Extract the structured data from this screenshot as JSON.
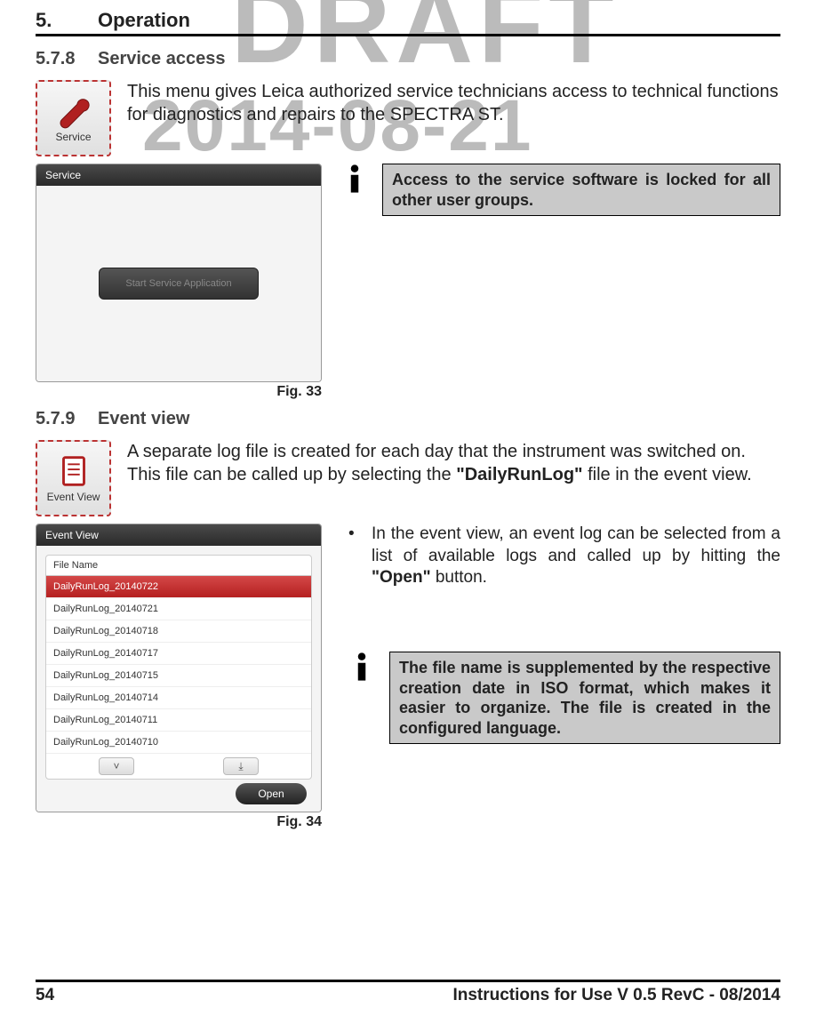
{
  "watermark": {
    "draft": "DRAFT",
    "date": "2014-08-21"
  },
  "chapter": {
    "num": "5.",
    "title": "Operation"
  },
  "sec578": {
    "num": "5.7.8",
    "title": "Service access",
    "icon_label": "Service",
    "intro": "This menu gives Leica authorized service technicians access to technical functions for diagnostics and repairs to the SPECTRA ST.",
    "screenshot_title": "Service",
    "service_btn": "Start Service Application",
    "fig": "Fig. 33",
    "note": "Access to the service software is locked for all other user groups."
  },
  "sec579": {
    "num": "5.7.9",
    "title": "Event view",
    "icon_label": "Event View",
    "intro_a": "A separate log file is created for each day that the instrument was switched on. This file can be called up by selecting the ",
    "intro_b": "\"DailyRunLog\"",
    "intro_c": " file in the event view.",
    "screenshot_title": "Event View",
    "file_header": "File Name",
    "files": [
      "DailyRunLog_20140722",
      "DailyRunLog_20140721",
      "DailyRunLog_20140718",
      "DailyRunLog_20140717",
      "DailyRunLog_20140715",
      "DailyRunLog_20140714",
      "DailyRunLog_20140711",
      "DailyRunLog_20140710"
    ],
    "open_btn": "Open",
    "fig": "Fig. 34",
    "bullet_a": "In the event view, an event log can be selected from a list of available logs and called up by hitting the ",
    "bullet_b": "\"Open\"",
    "bullet_c": " button.",
    "note": "The file name is supplemented by the respective creation date in ISO format, which makes it easier to organize. The file is created in the configured language."
  },
  "footer": {
    "page": "54",
    "doc": "Instructions for Use V 0.5 RevC - 08/2014"
  }
}
